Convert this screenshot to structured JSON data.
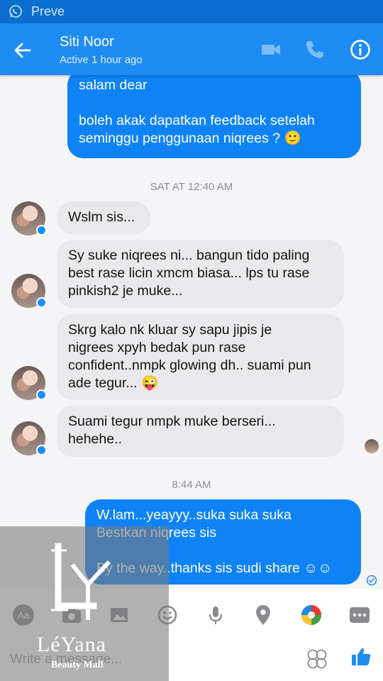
{
  "status_bar": {
    "app_label": "Preve"
  },
  "header": {
    "name": "Siti Noor",
    "status": "Active 1 hour ago"
  },
  "messages": [
    {
      "lines": [
        "salam dear",
        "",
        "boleh akak dapatkan feedback setelah",
        "seminggu penggunaan niqrees ? 🙂"
      ]
    },
    {
      "timestamp": "SAT AT 12:40 AM"
    },
    {
      "lines": [
        "Wslm sis..."
      ]
    },
    {
      "lines": [
        "Sy suke niqrees ni... bangun tido paling",
        "best rase licin xmcm biasa... lps tu rase",
        "pinkish2 je muke..."
      ]
    },
    {
      "lines": [
        "Skrg kalo nk kluar sy sapu jipis je",
        "nigrees xpyh bedak pun rase",
        "confident..nmpk glowing dh.. suami pun",
        "ade tegur... 😜"
      ]
    },
    {
      "lines": [
        "Suami tegur nmpk muke berseri...",
        "hehehe.."
      ]
    },
    {
      "timestamp": "8:44 AM"
    },
    {
      "lines": [
        "W.lam...yeayyy..suka suka suka",
        "Bestkan niqrees sis",
        "",
        "By the way..thanks sis sudi share ☺☺"
      ]
    }
  ],
  "composer": {
    "placeholder": "Write a message..."
  },
  "watermark": {
    "brand": "LéYana",
    "subtitle": "Beauty Mall"
  },
  "colors": {
    "header": "#1e8cf2",
    "status_bar": "#0a6ecf",
    "outgoing": "#0f83f6",
    "incoming": "#e9e9ec"
  },
  "icons": [
    "whatsapp-icon",
    "back-arrow-icon",
    "video-call-icon",
    "phone-icon",
    "info-icon",
    "text-format-icon",
    "camera-icon",
    "gallery-icon",
    "emoji-icon",
    "microphone-icon",
    "location-icon",
    "games-icon",
    "more-icon",
    "stickers-icon",
    "thumbs-up-icon"
  ]
}
